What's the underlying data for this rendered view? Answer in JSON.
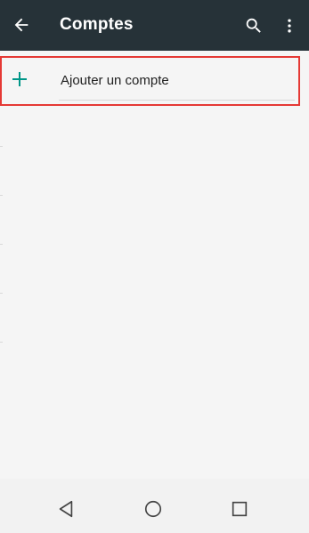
{
  "toolbar": {
    "title": "Comptes",
    "back_icon": "arrow-back-icon",
    "search_icon": "search-icon",
    "more_icon": "more-vert-icon"
  },
  "accounts_list": {
    "add_account_label": "Ajouter un compte",
    "add_icon": "plus-icon",
    "highlight_color": "#e53935",
    "accent_color": "#009688"
  },
  "navbar": {
    "back_icon": "nav-back-icon",
    "home_icon": "nav-home-icon",
    "recents_icon": "nav-recents-icon"
  },
  "colors": {
    "toolbar_bg": "#263238",
    "background": "#f5f5f5"
  }
}
